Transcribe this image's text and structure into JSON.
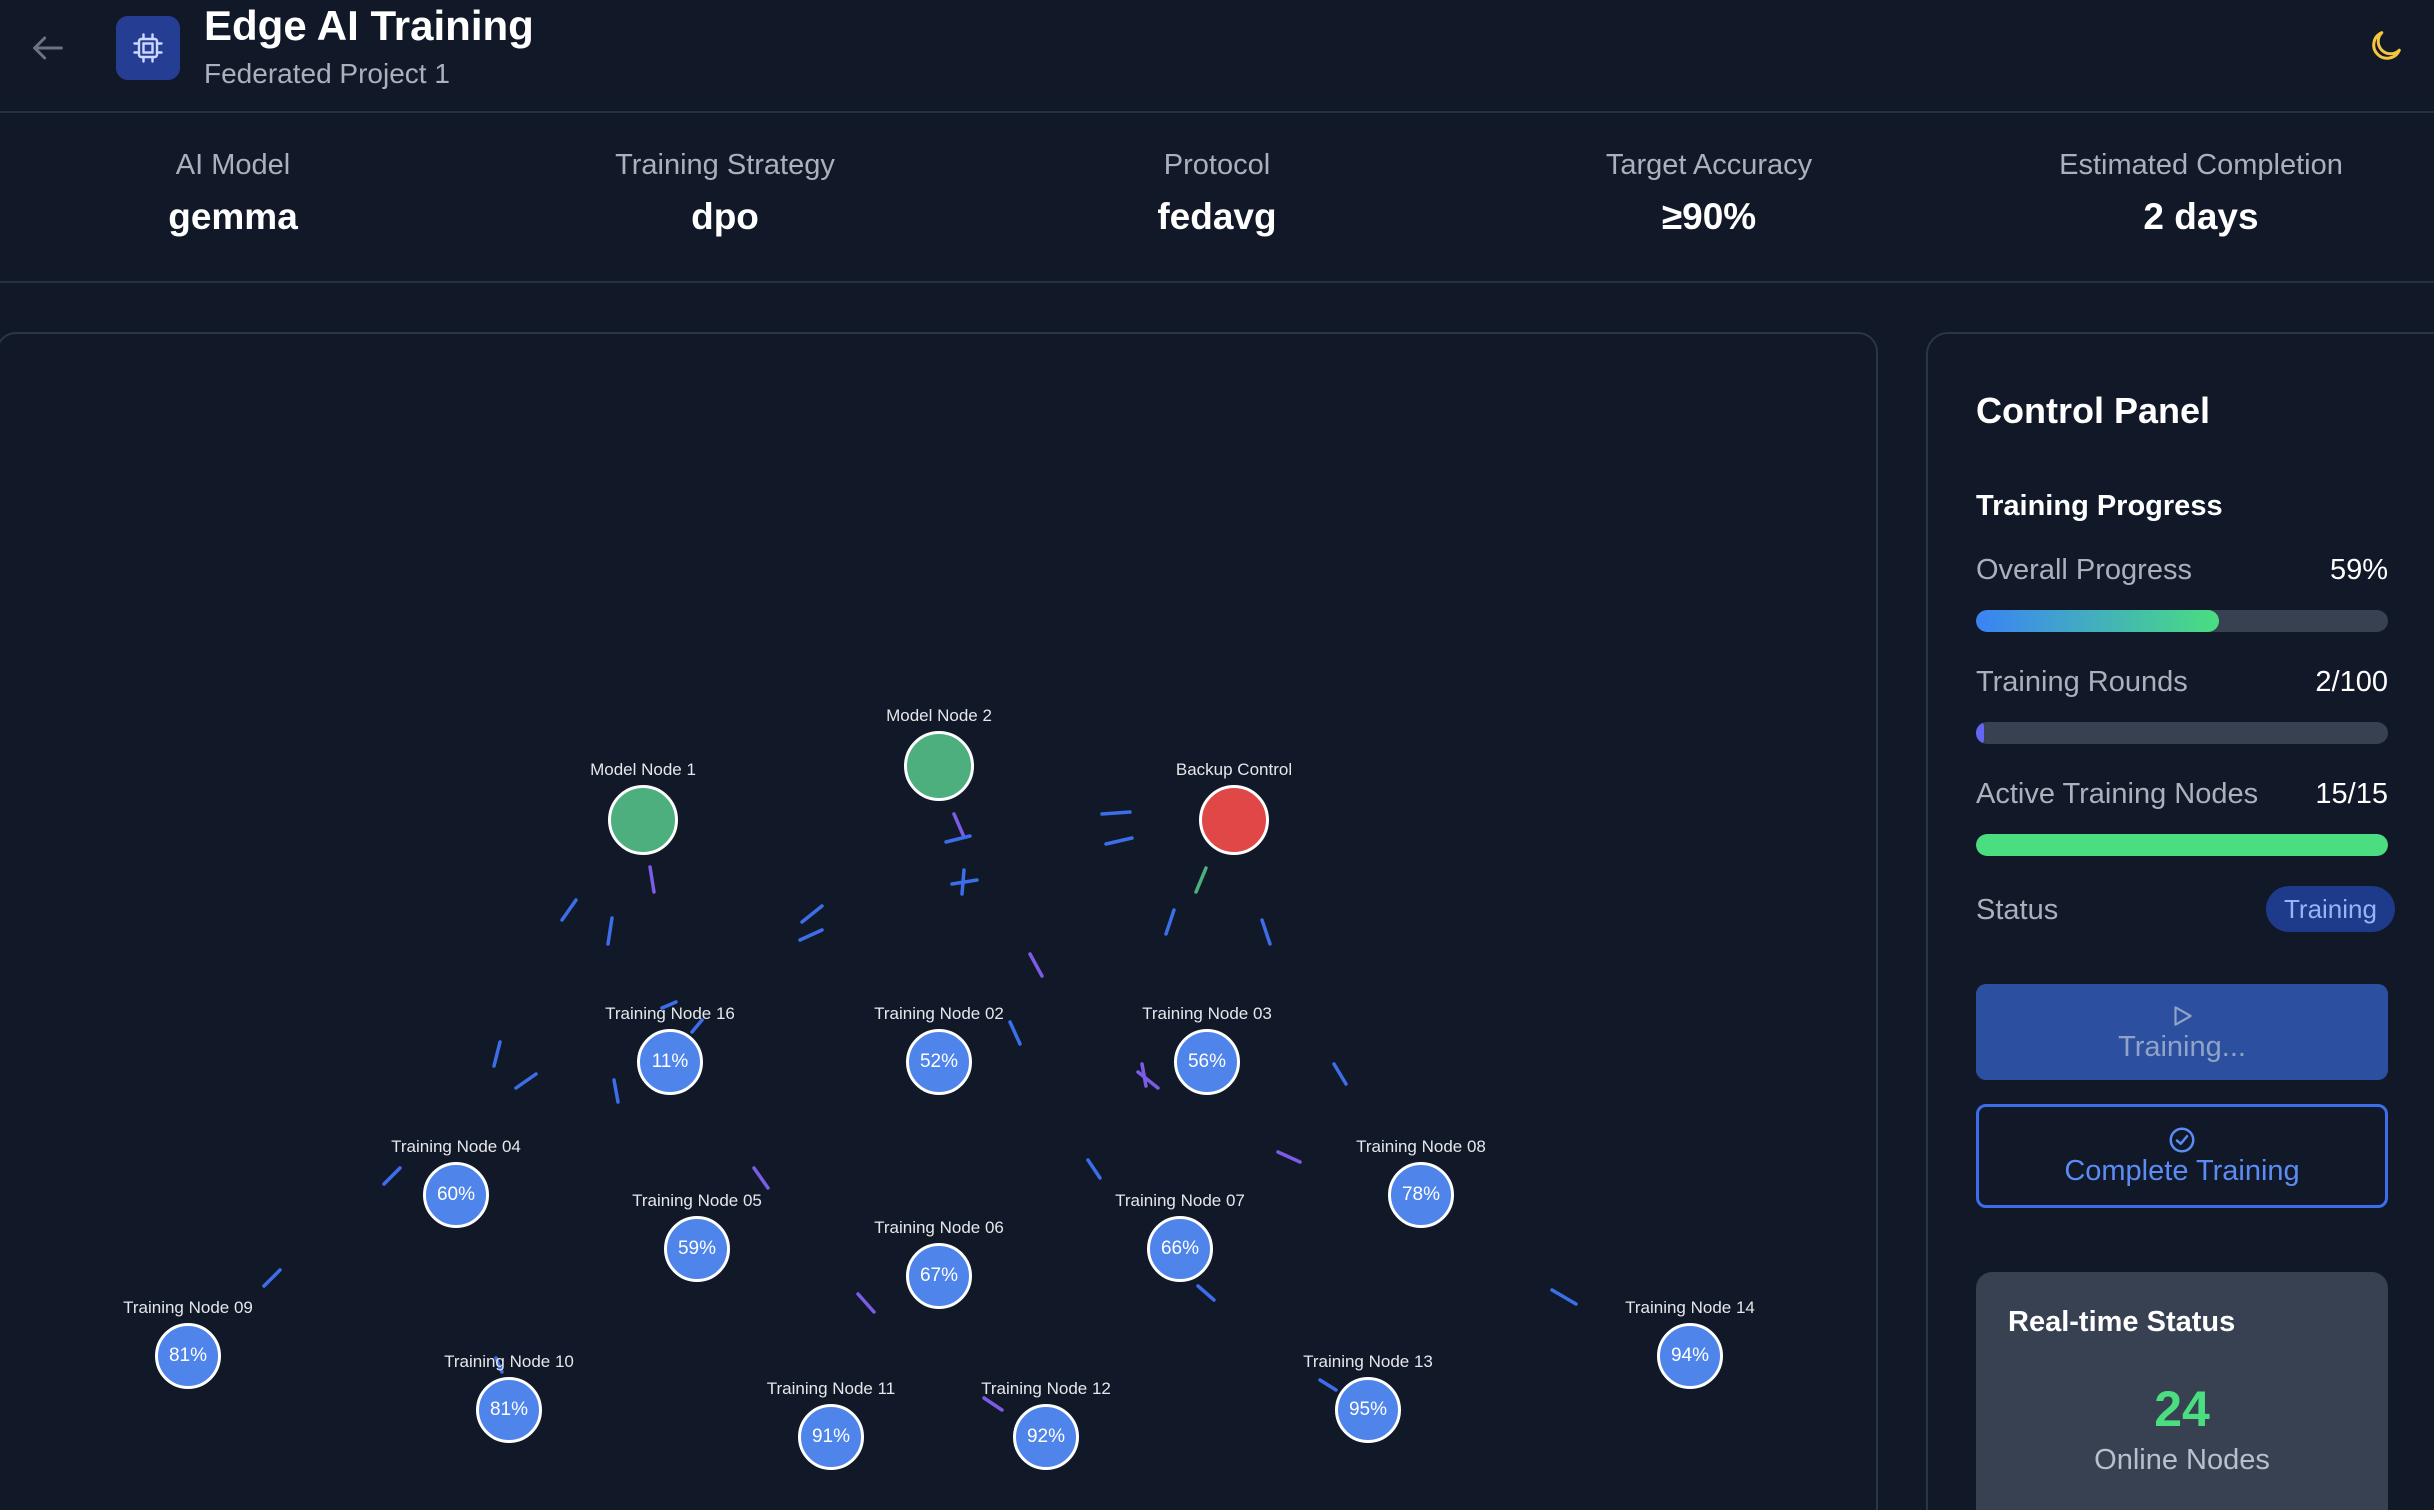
{
  "header": {
    "title": "Edge AI Training",
    "subtitle": "Federated Project 1",
    "back_icon": "arrow-left-icon",
    "logo_icon": "cpu-chip-icon",
    "theme_icon": "moon-icon"
  },
  "stats": [
    {
      "label": "AI Model",
      "value": "gemma"
    },
    {
      "label": "Training Strategy",
      "value": "dpo"
    },
    {
      "label": "Protocol",
      "value": "fedavg"
    },
    {
      "label": "Target Accuracy",
      "value": "≥90%"
    },
    {
      "label": "Estimated Completion",
      "value": "2 days"
    }
  ],
  "network": {
    "control_nodes": [
      {
        "label": "Model Node 1",
        "color": "#4caf7d"
      },
      {
        "label": "Model Node 2",
        "color": "#4caf7d"
      },
      {
        "label": "Backup Control",
        "color": "#e04848"
      }
    ],
    "training_nodes": [
      {
        "label": "Training Node 16",
        "progress": "11%"
      },
      {
        "label": "Training Node 02",
        "progress": "52%"
      },
      {
        "label": "Training Node 03",
        "progress": "56%"
      },
      {
        "label": "Training Node 04",
        "progress": "60%"
      },
      {
        "label": "Training Node 05",
        "progress": "59%"
      },
      {
        "label": "Training Node 06",
        "progress": "67%"
      },
      {
        "label": "Training Node 07",
        "progress": "66%"
      },
      {
        "label": "Training Node 08",
        "progress": "78%"
      },
      {
        "label": "Training Node 09",
        "progress": "81%"
      },
      {
        "label": "Training Node 10",
        "progress": "81%"
      },
      {
        "label": "Training Node 11",
        "progress": "91%"
      },
      {
        "label": "Training Node 12",
        "progress": "92%"
      },
      {
        "label": "Training Node 13",
        "progress": "95%"
      },
      {
        "label": "Training Node 14",
        "progress": "94%"
      }
    ],
    "colors": {
      "training_node": "#4f84ea",
      "link_blue": "#3b6ee8",
      "link_purple": "#7c5ce6",
      "link_green": "#4caf7d"
    }
  },
  "control_panel": {
    "title": "Control Panel",
    "section_title": "Training Progress",
    "overall_progress": {
      "label": "Overall Progress",
      "value": "59%",
      "fraction": 0.59
    },
    "training_rounds": {
      "label": "Training Rounds",
      "value": "2/100",
      "fraction": 0.02
    },
    "active_nodes": {
      "label": "Active Training Nodes",
      "value": "15/15",
      "fraction": 1.0
    },
    "status": {
      "label": "Status",
      "value": "Training"
    },
    "training_button": {
      "label": "Training...",
      "icon": "play-icon"
    },
    "complete_button": {
      "label": "Complete Training",
      "icon": "check-circle-icon"
    },
    "realtime": {
      "title": "Real-time Status",
      "online_count": "24",
      "online_label": "Online Nodes"
    }
  }
}
